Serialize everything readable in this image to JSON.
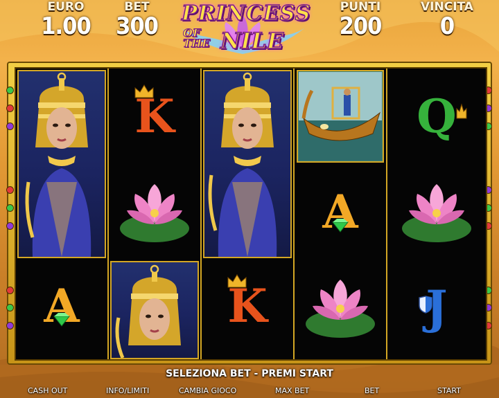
{
  "header": {
    "euro_label": "EURO",
    "euro_value": "1.00",
    "bet_label": "BET",
    "bet_value": "300",
    "punti_label": "PUNTI",
    "punti_value": "200",
    "vincita_label": "VINCITA",
    "vincita_value": "0"
  },
  "logo": {
    "line1": "PRINCESS",
    "line2": "OF",
    "line3": "THE",
    "line4": "NILE"
  },
  "reels": [
    [
      "princess-tall",
      "A"
    ],
    [
      "K",
      "lotus",
      "princess-tall"
    ],
    [
      "princess-tall",
      "K"
    ],
    [
      "boat",
      "A",
      "lotus"
    ],
    [
      "Q",
      "lotus",
      "J"
    ]
  ],
  "colors": {
    "frame_gold": "#e8c23a",
    "ace": "#f2a826",
    "king": "#e8531c",
    "queen": "#36b23c",
    "jack": "#2a6fd9"
  },
  "status_text": "SELEZIONA BET - PREMI START",
  "buttons": {
    "cash_out": "CASH OUT",
    "info_limiti": "INFO/LIMITI",
    "cambia_gioco": "CAMBIA GIOCO",
    "max_bet": "MAX BET",
    "bet": "BET",
    "start": "START"
  }
}
